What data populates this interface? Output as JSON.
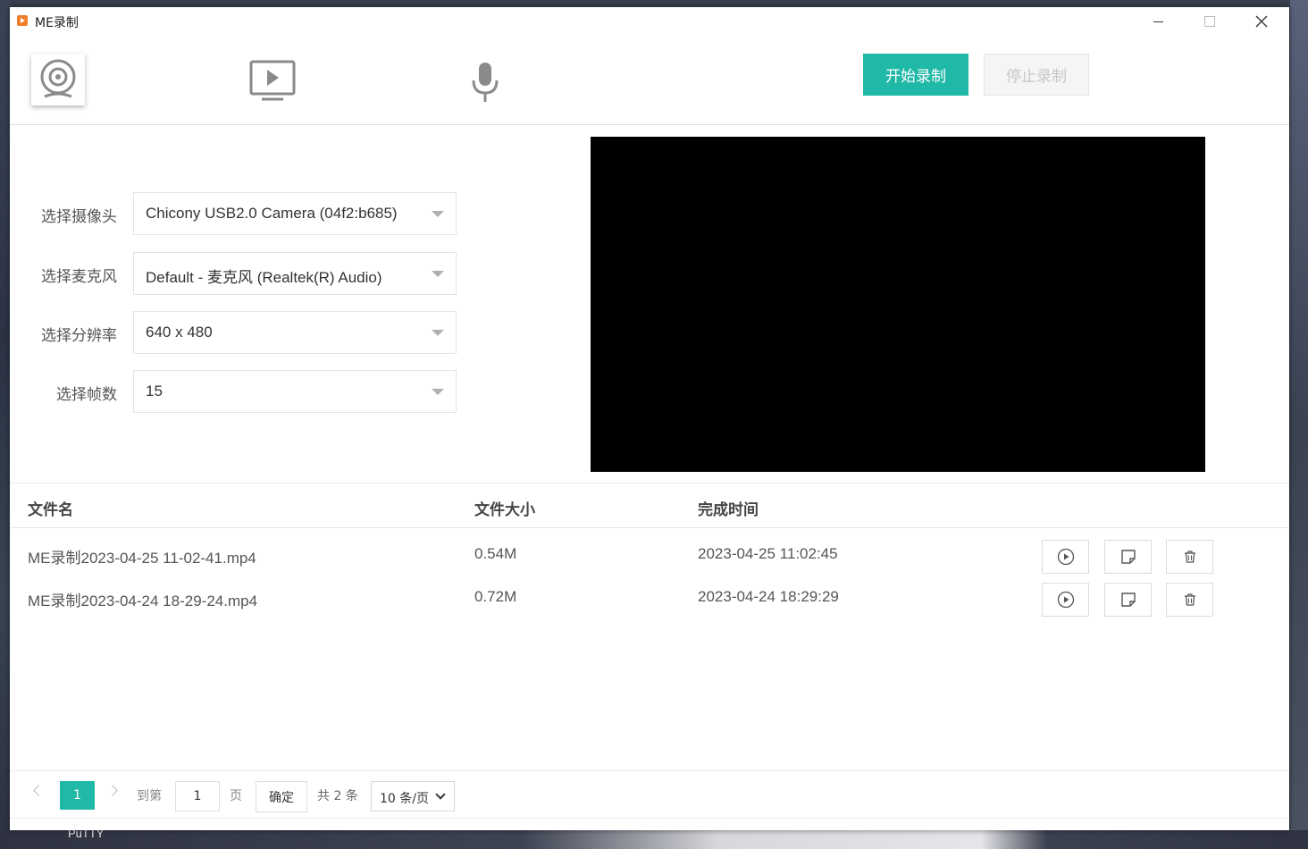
{
  "window": {
    "title": "ME录制"
  },
  "desktop": {
    "bottom_label": "PuTTY"
  },
  "toolbar": {
    "modes": [
      {
        "name": "camera",
        "icon": "webcam-icon"
      },
      {
        "name": "screen",
        "icon": "screen-play-icon"
      },
      {
        "name": "microphone",
        "icon": "microphone-icon"
      }
    ],
    "start_label": "开始录制",
    "stop_label": "停止录制"
  },
  "settings": [
    {
      "label": "选择摄像头",
      "value": "Chicony USB2.0 Camera (04f2:b685)"
    },
    {
      "label": "选择麦克风",
      "value": "Default - 麦克风 (Realtek(R) Audio)"
    },
    {
      "label": "选择分辨率",
      "value": "640 x 480"
    },
    {
      "label": "选择帧数",
      "value": "15"
    }
  ],
  "table": {
    "headers": {
      "name": "文件名",
      "size": "文件大小",
      "time": "完成时间"
    },
    "rows": [
      {
        "name": "ME录制2023-04-25 11-02-41.mp4",
        "size": "0.54M",
        "time": "2023-04-25 11:02:45"
      },
      {
        "name": "ME录制2023-04-24 18-29-24.mp4",
        "size": "0.72M",
        "time": "2023-04-24 18:29:29"
      }
    ],
    "actions": [
      "play-icon",
      "note-icon",
      "trash-icon"
    ]
  },
  "pagination": {
    "current": "1",
    "goto_label": "到第",
    "goto_value": "1",
    "page_label": "页",
    "confirm_label": "确定",
    "total_label": "共 2 条",
    "page_size": "10 条/页"
  },
  "colors": {
    "accent": "#20b8a6",
    "disabled_bg": "#f5f5f5"
  }
}
